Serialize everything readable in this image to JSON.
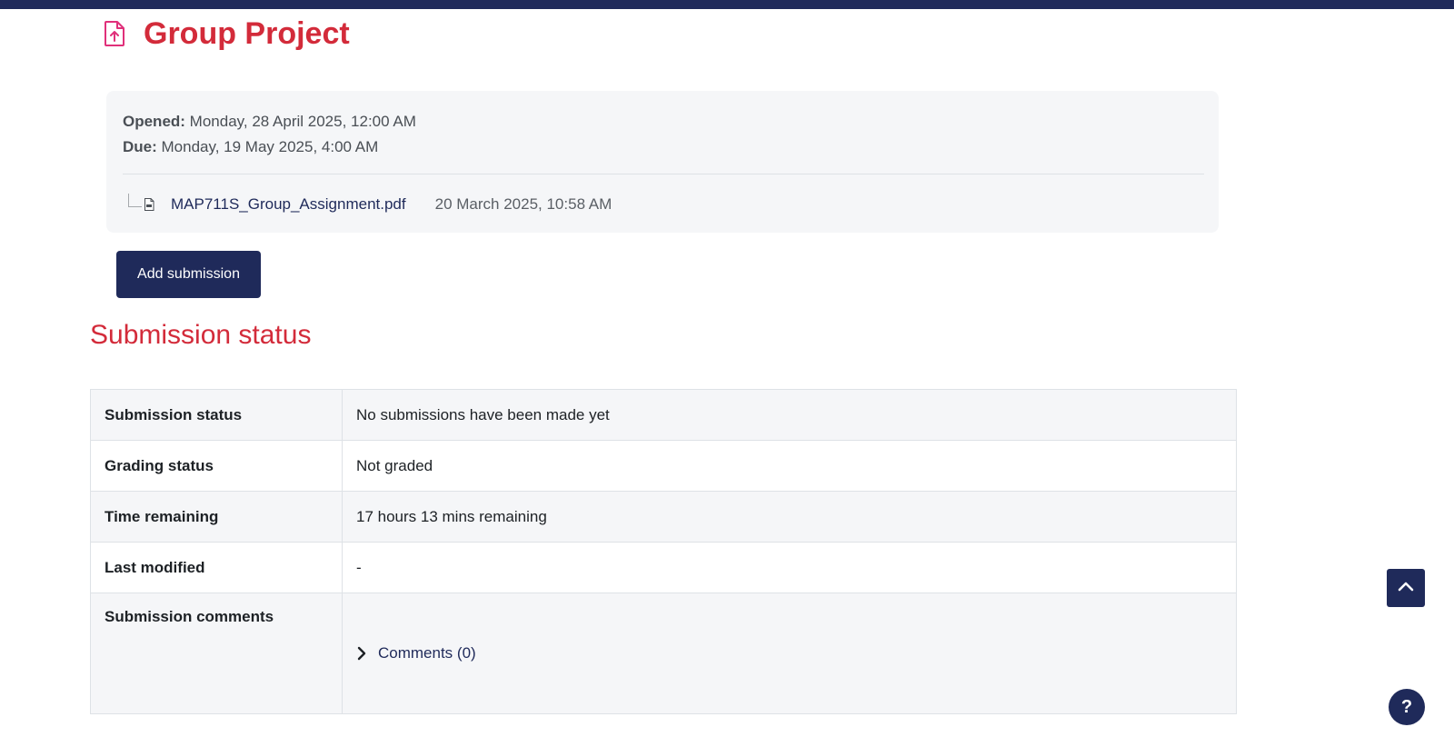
{
  "header": {
    "title": "Group Project",
    "icon": "assignment-upload-icon"
  },
  "dates": {
    "opened_label": "Opened:",
    "opened_value": " Monday, 28 April 2025, 12:00 AM",
    "due_label": "Due:",
    "due_value": " Monday, 19 May 2025, 4:00 AM"
  },
  "attachment": {
    "filename": "MAP711S_Group_Assignment.pdf",
    "date": "20 March 2025, 10:58 AM",
    "icon": "pdf-file-icon"
  },
  "actions": {
    "add_submission_label": "Add submission"
  },
  "submission": {
    "section_title": "Submission status",
    "rows": [
      {
        "label": "Submission status",
        "value": "No submissions have been made yet"
      },
      {
        "label": "Grading status",
        "value": "Not graded"
      },
      {
        "label": "Time remaining",
        "value": "17 hours 13 mins remaining"
      },
      {
        "label": "Last modified",
        "value": "-"
      },
      {
        "label": "Submission comments",
        "value": "Comments (0)"
      }
    ]
  },
  "floating": {
    "back_to_top_icon": "chevron-up-icon",
    "help_label": "?"
  },
  "colors": {
    "brand_navy": "#1f2a5a",
    "accent_red": "#d32b3a",
    "panel_bg": "#f5f6f8"
  }
}
